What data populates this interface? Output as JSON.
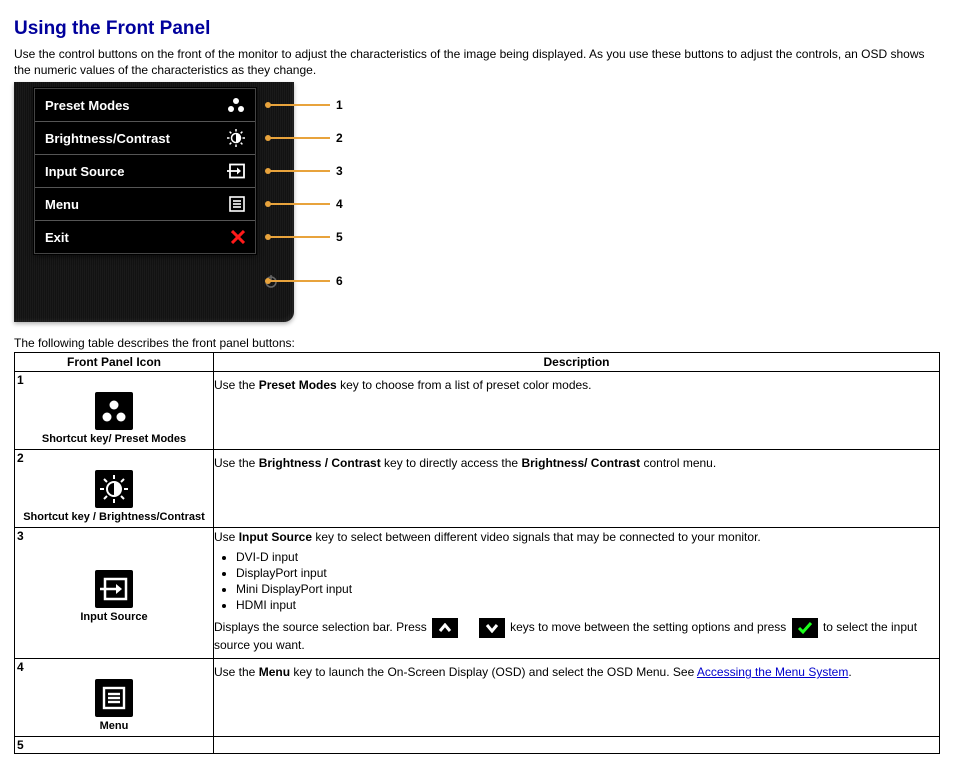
{
  "heading": "Using the Front Panel",
  "intro": "Use the control buttons on the front of the monitor to adjust the characteristics of the image being displayed. As you use these buttons to adjust the controls, an OSD shows the numeric values of the characteristics as they change.",
  "osd": {
    "items": [
      {
        "label": "Preset Modes"
      },
      {
        "label": "Brightness/Contrast"
      },
      {
        "label": "Input Source"
      },
      {
        "label": "Menu"
      },
      {
        "label": "Exit"
      }
    ],
    "callouts": [
      "1",
      "2",
      "3",
      "4",
      "5",
      "6"
    ]
  },
  "table_caption": "The following table describes the front panel buttons:",
  "headers": {
    "col1": "Front Panel Icon",
    "col2": "Description"
  },
  "rows": [
    {
      "num": "1",
      "icon_label": "Shortcut key/ Preset Modes",
      "desc_pre": "Use the ",
      "desc_bold": "Preset Modes",
      "desc_post": " key to choose from a list of preset color modes."
    },
    {
      "num": "2",
      "icon_label": "Shortcut key / Brightness/Contrast",
      "desc_pre": "Use the ",
      "desc_bold": "Brightness / Contrast",
      "desc_mid": " key to directly access the ",
      "desc_bold2": "Brightness/ Contrast",
      "desc_post": " control menu."
    },
    {
      "num": "3",
      "icon_label": "Input Source",
      "l1_pre": "Use ",
      "l1_bold": "Input Source",
      "l1_post": " key to select between different video signals that may be connected to your monitor.",
      "bullets": [
        "DVI-D input",
        "DisplayPort input",
        "Mini DisplayPort input",
        "HDMI input"
      ],
      "l2_a": "Displays the source selection bar. Press ",
      "l2_b": " keys to move between the setting options and press ",
      "l2_c": " to select the input source you want."
    },
    {
      "num": "4",
      "icon_label": "Menu",
      "desc_pre": "Use the ",
      "desc_bold": "Menu",
      "desc_mid": " key to launch the On-Screen Display (OSD) and select the OSD Menu. See ",
      "link": "Accessing the Menu System",
      "desc_post": "."
    },
    {
      "num": "5"
    }
  ]
}
